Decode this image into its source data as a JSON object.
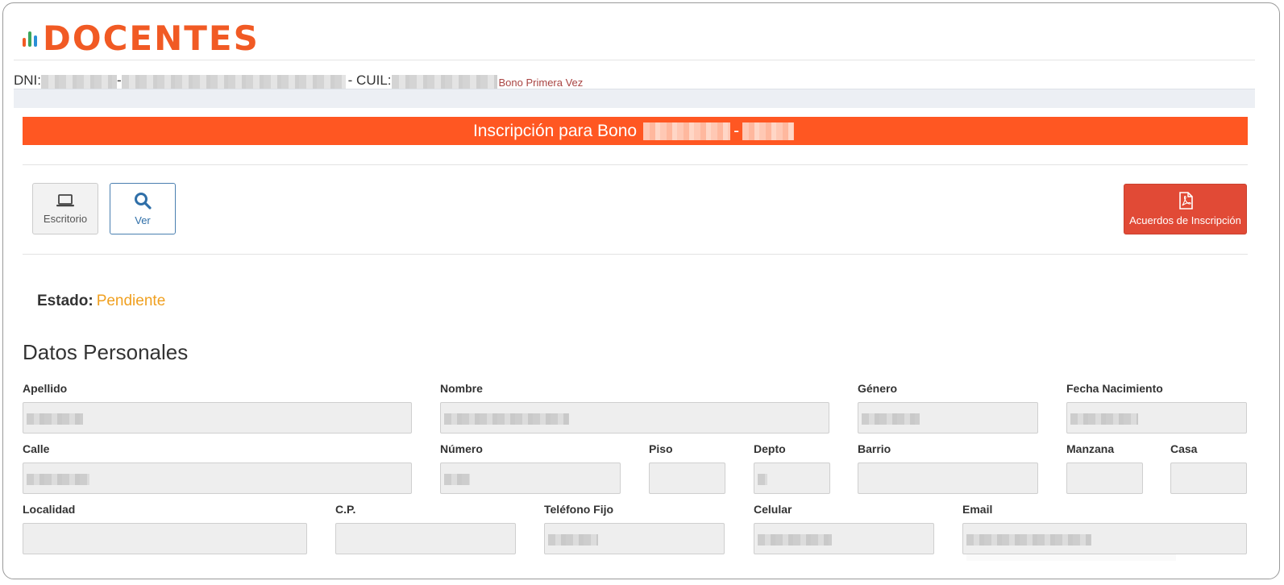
{
  "logo": {
    "text": "DOCENTES",
    "bar_colors": [
      "#f15a24",
      "#3ba55c",
      "#2a8fd6"
    ]
  },
  "id_line": {
    "dni_label": "DNI:",
    "separator": "-",
    "cuil_label": "- CUIL:",
    "mode": "Bono Primera Vez"
  },
  "banner": {
    "title": "Inscripción para Bono",
    "separator": "-"
  },
  "toolbar": {
    "escritorio_label": "Escritorio",
    "ver_label": "Ver",
    "acuerdos_label": "Acuerdos de Inscripción"
  },
  "estado": {
    "label": "Estado:",
    "value": "Pendiente",
    "value_color": "#f0a020"
  },
  "section_title": "Datos Personales",
  "form": {
    "apellido": "Apellido",
    "nombre": "Nombre",
    "genero": "Género",
    "fecha_nacimiento": "Fecha Nacimiento",
    "calle": "Calle",
    "numero": "Número",
    "piso": "Piso",
    "depto": "Depto",
    "barrio": "Barrio",
    "manzana": "Manzana",
    "casa": "Casa",
    "localidad": "Localidad",
    "cp": "C.P.",
    "telefono_fijo": "Teléfono Fijo",
    "celular": "Celular",
    "email": "Email"
  },
  "colors": {
    "accent": "#ff5722",
    "pdf_button": "#e14a36",
    "estado": "#f0a020",
    "mode_link": "#a94442"
  }
}
